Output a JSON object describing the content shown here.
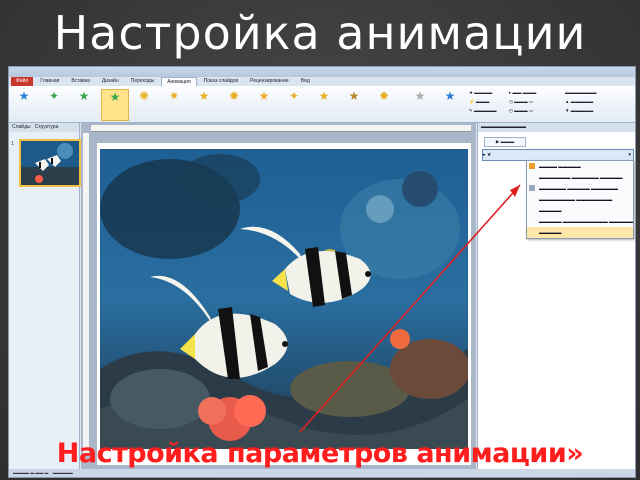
{
  "slide": {
    "title": "Настройка анимации",
    "caption": "Настройка параметров анимации»"
  },
  "app": {
    "titlebar": "",
    "tabs": [
      {
        "label": "Файл"
      },
      {
        "label": "Главная"
      },
      {
        "label": "Вставка"
      },
      {
        "label": "Дизайн"
      },
      {
        "label": "Переходы"
      },
      {
        "label": "Анимация"
      },
      {
        "label": "Показ слайдов"
      },
      {
        "label": "Рецензирование"
      },
      {
        "label": "Вид"
      }
    ]
  },
  "left_pane": {
    "tabs": [
      "Слайды",
      "Структура"
    ],
    "thumb_number": "1"
  },
  "colors": {
    "accent": "#f0c040",
    "caption_red": "#ff1e1e",
    "arrow_red": "#e02020",
    "file_tab": "#c8382b"
  },
  "icons": {
    "star": "star-icon",
    "dropdown": "chevron-down-icon",
    "animation_entry": "animation-effect-icon"
  }
}
